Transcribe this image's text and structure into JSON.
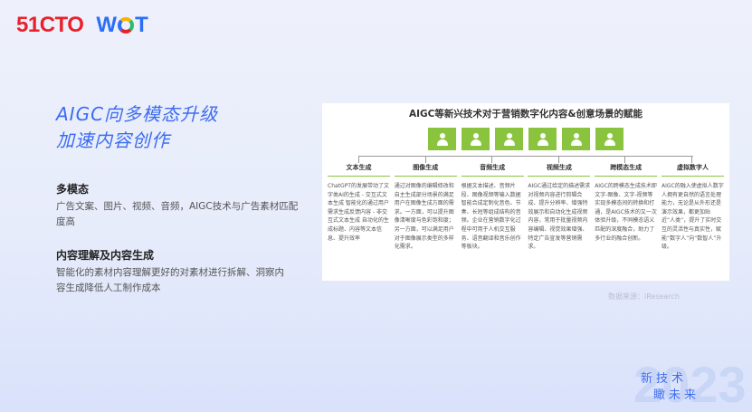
{
  "logo": {
    "left": "51CTO",
    "right_prefix": "W",
    "right_suffix": "T"
  },
  "main_title": {
    "line1": "AIGC向多模态升级",
    "line2": "加速内容创作"
  },
  "sections": [
    {
      "heading": "多模态",
      "text": "广告文案、图片、视频、音频，AIGC技术与广告素材匹配度高"
    },
    {
      "heading": "内容理解及内容生成",
      "text": "智能化的素材内容理解更好的对素材进行拆解、洞察内容生成降低人工制作成本"
    }
  ],
  "card": {
    "title": "AIGC等新兴技术对于营销数字化内容&创意场景的赋能",
    "icon_name": "person-icon",
    "icon_color": "#8ac43f",
    "columns": [
      {
        "head": "文本生成",
        "text": "ChatGPT的发展带动了文字类AI的生成 - 交互式文本生成 智能化的通过用户需求生成反馈内容 - 非交互式文本生成 自动化的生成标题、内容等文本信息、提升效率"
      },
      {
        "head": "图像生成",
        "text": "通过对图像的编辑修改和自主生成部分场景的满足用户在图像生成方面的需求。一方面，可以提升图像清晰度与色彩饱和度；另一方面，可以满足用户对于图像展示类型的多样化需求。"
      },
      {
        "head": "音频生成",
        "text": "根据文本描述、音频片段、图像视频等输入数据智能合成定制化音色、节奏、长短等组成结构的音频。企业在营销数字化过程中可用于人机交互服务、语音翻译和音乐创作等板块。"
      },
      {
        "head": "视频生成",
        "text": "AIGC通过给定的描述需求对视频内容进行剪辑合成、提升分辨率、增强特效展示和自动化生成视频内容，常用于批量视频内容编辑、视觉效果增强、特定广告宣发等营销需求。"
      },
      {
        "head": "跨模态生成",
        "text": "AIGC的跨模态生成技术即文字-图像、文字-视频等实现多模态间的转换和打通，是AIGC技术的又一次体验升级，不同模态语义匹配的深度融合，助力了多行业的融合创新。"
      },
      {
        "head": "虚拟数字人",
        "text": "AIGC的融入使虚拟人数字人拥有更自然的语言处理能力，无论是从外形还是演示效果，都更加贴近“人类”，提升了实时交互的灵活性与真实性，赋能“数字人”向“数智人”升级。"
      }
    ]
  },
  "source": "数据来源：iResearch",
  "slogan": {
    "line1": "新技术",
    "line2": "瞰未来",
    "year": "2023"
  }
}
